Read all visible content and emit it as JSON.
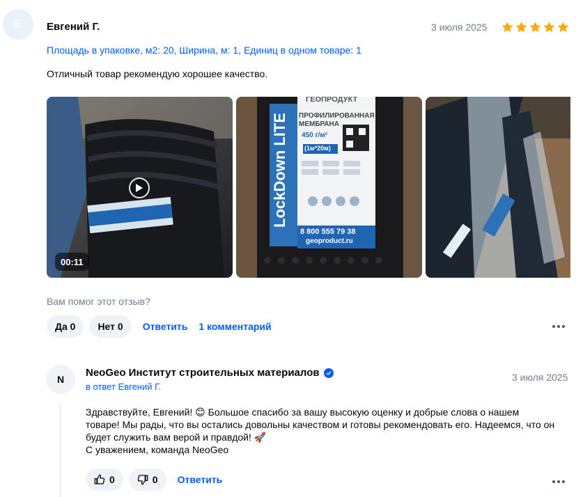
{
  "review": {
    "avatar_letter": "Е",
    "author": "Евгений Г.",
    "date": "3 июля 2025",
    "rating": 5,
    "specs": "Площадь в упаковке, м2: 20, Ширина, м: 1, Единиц в одном товаре: 1",
    "text": "Отличный товар рекомендую хорошее качество.",
    "video_duration": "00:11",
    "photo_texts": {
      "brand": "ГЕОПРОДУКТ",
      "product_line1": "ПРОФИЛИРОВАННАЯ",
      "product_line2": "МЕМБРАНА",
      "density": "450 г/м²",
      "size": "(1м*20м)",
      "name": "LockDown LITE",
      "phone": "8 800 555 79 38",
      "site": "geoproduct.ru"
    },
    "helpful_question": "Вам помог этот отзыв?",
    "yes_label": "Да 0",
    "no_label": "Нет 0",
    "answer_label": "Ответить",
    "comments_label": "1 комментарий"
  },
  "reply": {
    "avatar_letter": "N",
    "seller": "NeoGeo Институт строительных материалов",
    "in_reply_to": "в ответ Евгений Г.",
    "date": "3 июля 2025",
    "lines": [
      "Здравствуйте, Евгений! 😊 Большое спасибо за вашу высокую оценку и добрые слова о нашем",
      "товаре! Мы рады, что вы остались довольны качеством и готовы рекомендовать его. Надеемся, что он",
      "будет служить вам верой и правдой! 🚀",
      "С уважением, команда NeoGeo"
    ],
    "likes": "0",
    "dislikes": "0",
    "answer_label": "Ответить"
  },
  "colors": {
    "accent": "#005bff",
    "star": "#ffa800",
    "muted": "#707f8d"
  }
}
